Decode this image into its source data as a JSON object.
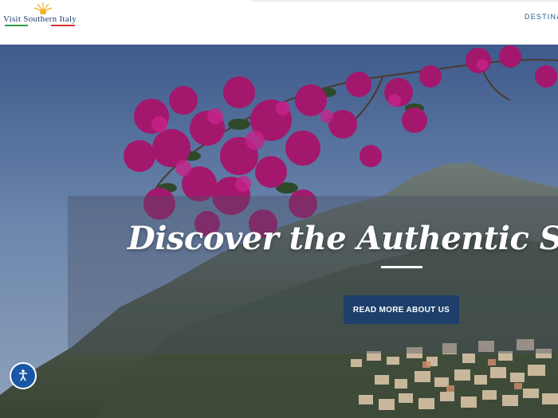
{
  "header": {
    "logo_text": "Visit Southern Italy",
    "nav": [
      "DESTINA"
    ]
  },
  "hero": {
    "title": "Discover the Authentic Soul of South",
    "button_label": "READ MORE ABOUT US"
  },
  "accessibility": {
    "icon": "accessibility-icon"
  },
  "colors": {
    "brand_blue": "#1e3f6b",
    "nav_blue": "#1c5a8f",
    "accessibility_blue": "#1c57a5"
  }
}
